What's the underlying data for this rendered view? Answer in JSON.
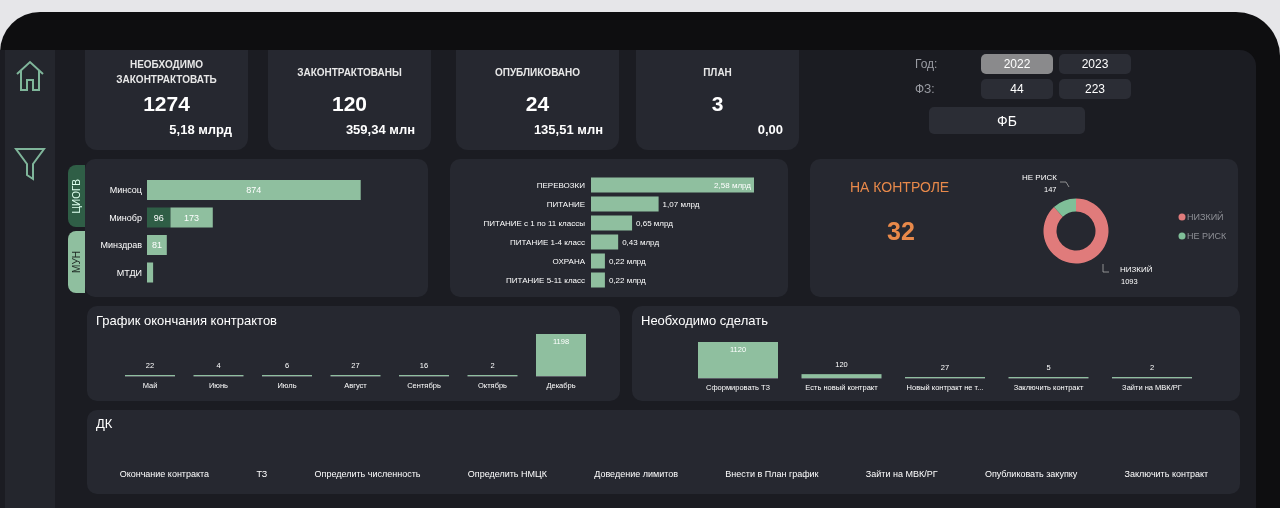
{
  "sidebar": {
    "items": [
      {
        "kind": "home"
      },
      {
        "kind": "filter"
      }
    ]
  },
  "kpis": [
    {
      "title": "НЕОБХОДИМО ЗАКОНТРАКТОВАТЬ",
      "count": "1274",
      "amount": "5,18 млрд"
    },
    {
      "title": "ЗАКОНТРАКТОВАНЫ",
      "count": "120",
      "amount": "359,34 млн"
    },
    {
      "title": "ОПУБЛИКОВАНО",
      "count": "24",
      "amount": "135,51 млн"
    },
    {
      "title": "ПЛАН",
      "count": "3",
      "amount": "0,00"
    }
  ],
  "filters": {
    "year_label": "Год:",
    "years": [
      {
        "label": "2022",
        "selected": true
      },
      {
        "label": "2023",
        "selected": false
      }
    ],
    "law_label": "ФЗ:",
    "laws": [
      {
        "label": "44",
        "selected": false
      },
      {
        "label": "223",
        "selected": false
      }
    ],
    "fund_button": "ФБ"
  },
  "departments": {
    "tabs": [
      {
        "label": "ЦИОГВ",
        "selected": true
      },
      {
        "label": "МУН",
        "selected": false
      }
    ],
    "chart_data": {
      "type": "bar",
      "orientation": "horizontal",
      "stacked": true,
      "categories": [
        "Минсоц",
        "Минобр",
        "Минздрав",
        "МТДИ"
      ],
      "series": [
        {
          "color": "#2f5e46",
          "values": [
            null,
            96,
            null,
            null
          ],
          "value_labels": [
            null,
            "96",
            null,
            null
          ]
        },
        {
          "color": "#8fbf9f",
          "values": [
            874,
            173,
            81,
            25
          ],
          "value_labels": [
            "874",
            "173",
            "81",
            null
          ]
        }
      ]
    }
  },
  "purchase_types": {
    "chart_data": {
      "type": "bar",
      "orientation": "horizontal",
      "categories": [
        "ПЕРЕВОЗКИ",
        "ПИТАНИЕ",
        "ПИТАНИЕ с 1 по 11 классы",
        "ПИТАНИЕ 1-4 класс",
        "ОХРАНА",
        "ПИТАНИЕ 5-11 класс"
      ],
      "series": [
        {
          "color": "#8fbf9f",
          "values": [
            2.58,
            1.07,
            0.65,
            0.43,
            0.22,
            0.22
          ],
          "value_labels": [
            "2,58 млрд",
            "1,07 млрд",
            "0,65 млрд",
            "0,43 млрд",
            "0,22 млрд",
            "0,22 млрд"
          ]
        }
      ]
    }
  },
  "control": {
    "title": "НА КОНТРОЛЕ",
    "value": "32",
    "chart_data": {
      "type": "donut",
      "categories": [
        "НИЗКИЙ",
        "НЕ РИСК"
      ],
      "series": [
        {
          "colors": [
            "#e07b7b",
            "#7fbf98"
          ],
          "values": [
            1093,
            147
          ],
          "value_labels": [
            "1093",
            "147"
          ]
        }
      ]
    },
    "legend": [
      {
        "label": "НИЗКИЙ",
        "color": "#e07b7b"
      },
      {
        "label": "НЕ РИСК",
        "color": "#7fbf98"
      }
    ]
  },
  "end_schedule": {
    "title": "График окончания контрактов",
    "chart_data": {
      "type": "bar",
      "data_labels": true,
      "categories": [
        "Май",
        "Июнь",
        "Июль",
        "Август",
        "Сентябрь",
        "Октябрь",
        "Декабрь"
      ],
      "series": [
        {
          "color": "#8fbf9f",
          "values": [
            22,
            4,
            6,
            27,
            16,
            2,
            1198
          ]
        }
      ]
    }
  },
  "todo": {
    "title": "Необходимо сделать",
    "chart_data": {
      "type": "bar",
      "data_labels": true,
      "grid": true,
      "categories": [
        "Сформировать ТЗ",
        "Есть новый контракт",
        "Новый контракт не т...",
        "Заключить контракт",
        "Зайти на МВК/РГ"
      ],
      "series": [
        {
          "color": "#8fbf9f",
          "values": [
            1120,
            120,
            27,
            5,
            2
          ]
        }
      ]
    }
  },
  "dk": {
    "title": "ДК",
    "columns": [
      "Окончание контракта",
      "ТЗ",
      "Определить численность",
      "Определить НМЦК",
      "Доведение лимитов",
      "Внести в План график",
      "Зайти на МВК/РГ",
      "Опубликовать закупку",
      "Заключить контракт"
    ]
  }
}
